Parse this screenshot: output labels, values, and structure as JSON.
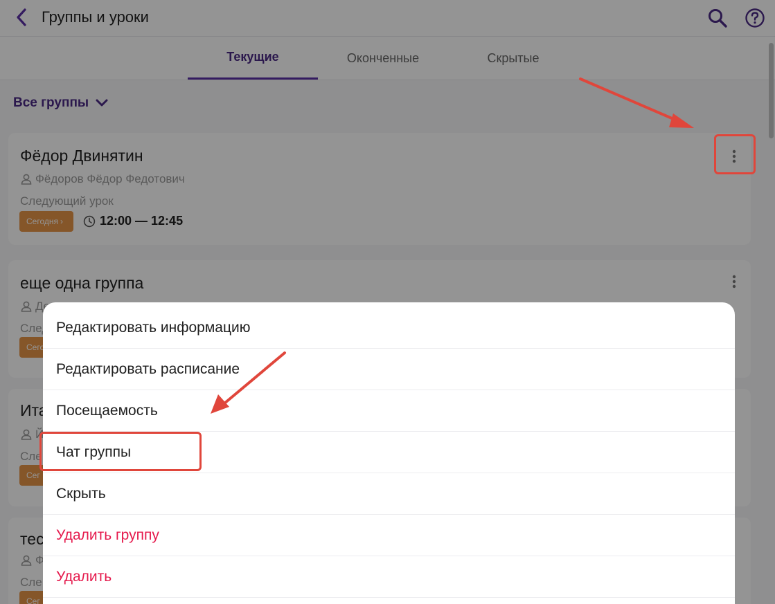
{
  "header": {
    "title": "Группы и уроки",
    "back_icon": "chevron-left-icon",
    "search_icon": "search-icon",
    "help_icon": "help-circle-icon"
  },
  "tabs": [
    {
      "label": "Текущие",
      "active": true
    },
    {
      "label": "Оконченные",
      "active": false
    },
    {
      "label": "Скрытые",
      "active": false
    }
  ],
  "filter": {
    "label": "Все группы"
  },
  "groups": [
    {
      "name": "Фёдор Двинятин",
      "teacher": "Фёдоров Фёдор Федотович",
      "next_label": "Следующий урок",
      "badge": "Сегодня",
      "time": "12:00 — 12:45"
    },
    {
      "name": "еще одна группа",
      "teacher": "Де",
      "next_label": "След",
      "badge": "Сего"
    },
    {
      "name": "Ита",
      "teacher": "Й",
      "next_label": "Сле",
      "badge": "Сег"
    },
    {
      "name": "тес",
      "teacher": "Ф",
      "next_label": "Сле",
      "badge": "Сег"
    }
  ],
  "menu": {
    "items": [
      {
        "label": "Редактировать информацию",
        "danger": false
      },
      {
        "label": "Редактировать расписание",
        "danger": false
      },
      {
        "label": "Посещаемость",
        "danger": false
      },
      {
        "label": "Чат группы",
        "danger": false
      },
      {
        "label": "Скрыть",
        "danger": false
      },
      {
        "label": "Удалить группу",
        "danger": true
      },
      {
        "label": "Удалить",
        "danger": true
      }
    ]
  },
  "colors": {
    "accent": "#5b2fa5",
    "badge": "#e69447",
    "danger": "#e5194c",
    "annotation": "#e0463b"
  }
}
